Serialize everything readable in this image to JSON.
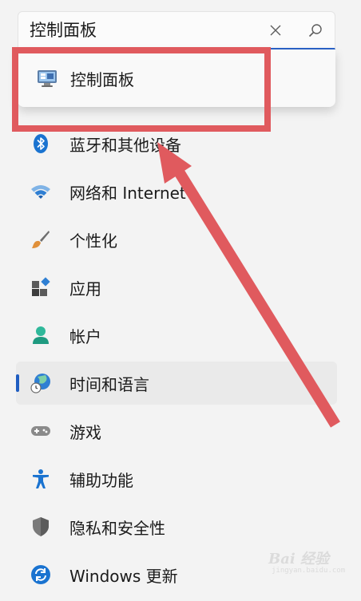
{
  "search": {
    "value": "控制面板"
  },
  "suggestion": {
    "label": "控制面板"
  },
  "nav": {
    "items": [
      {
        "label": "蓝牙和其他设备"
      },
      {
        "label": "网络和 Internet"
      },
      {
        "label": "个性化"
      },
      {
        "label": "应用"
      },
      {
        "label": "帐户"
      },
      {
        "label": "时间和语言",
        "selected": true
      },
      {
        "label": "游戏"
      },
      {
        "label": "辅助功能"
      },
      {
        "label": "隐私和安全性"
      },
      {
        "label": "Windows 更新"
      }
    ]
  },
  "annotation": {
    "highlight_color": "#e05a5e",
    "arrow_color": "#e05a5e"
  },
  "watermark": {
    "text": "Bai 经验",
    "sub": "jingyan.baidu.com"
  },
  "colors": {
    "accent": "#1f5dc1",
    "background": "#f3f3f3"
  }
}
